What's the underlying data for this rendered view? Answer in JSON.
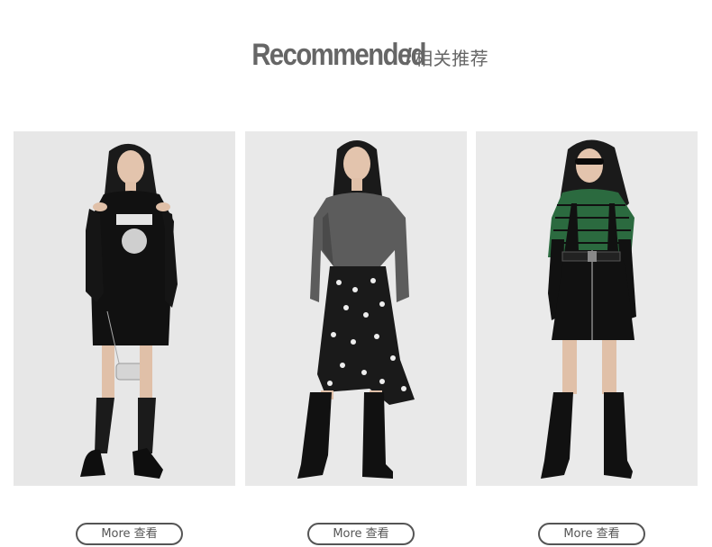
{
  "header": {
    "title_en": "Recommended",
    "separator": "/",
    "title_cn": "相关推荐"
  },
  "products": [
    {
      "image_alt": "Model wearing black cold-shoulder sweatshirt dress with graphic print, knee socks and loafers",
      "button_label": "More 查看"
    },
    {
      "image_alt": "Model wearing grey denim jacket over black and white polka-dot ruffle midi dress with tall black boots",
      "button_label": "More 查看"
    },
    {
      "image_alt": "Model wearing black zip-front pinafore dress over green patterned top with sunglasses and tall black boots",
      "button_label": "More 查看"
    }
  ],
  "colors": {
    "heading": "#666666",
    "button_border": "#555555",
    "photo_background": "#e9e9e9"
  }
}
